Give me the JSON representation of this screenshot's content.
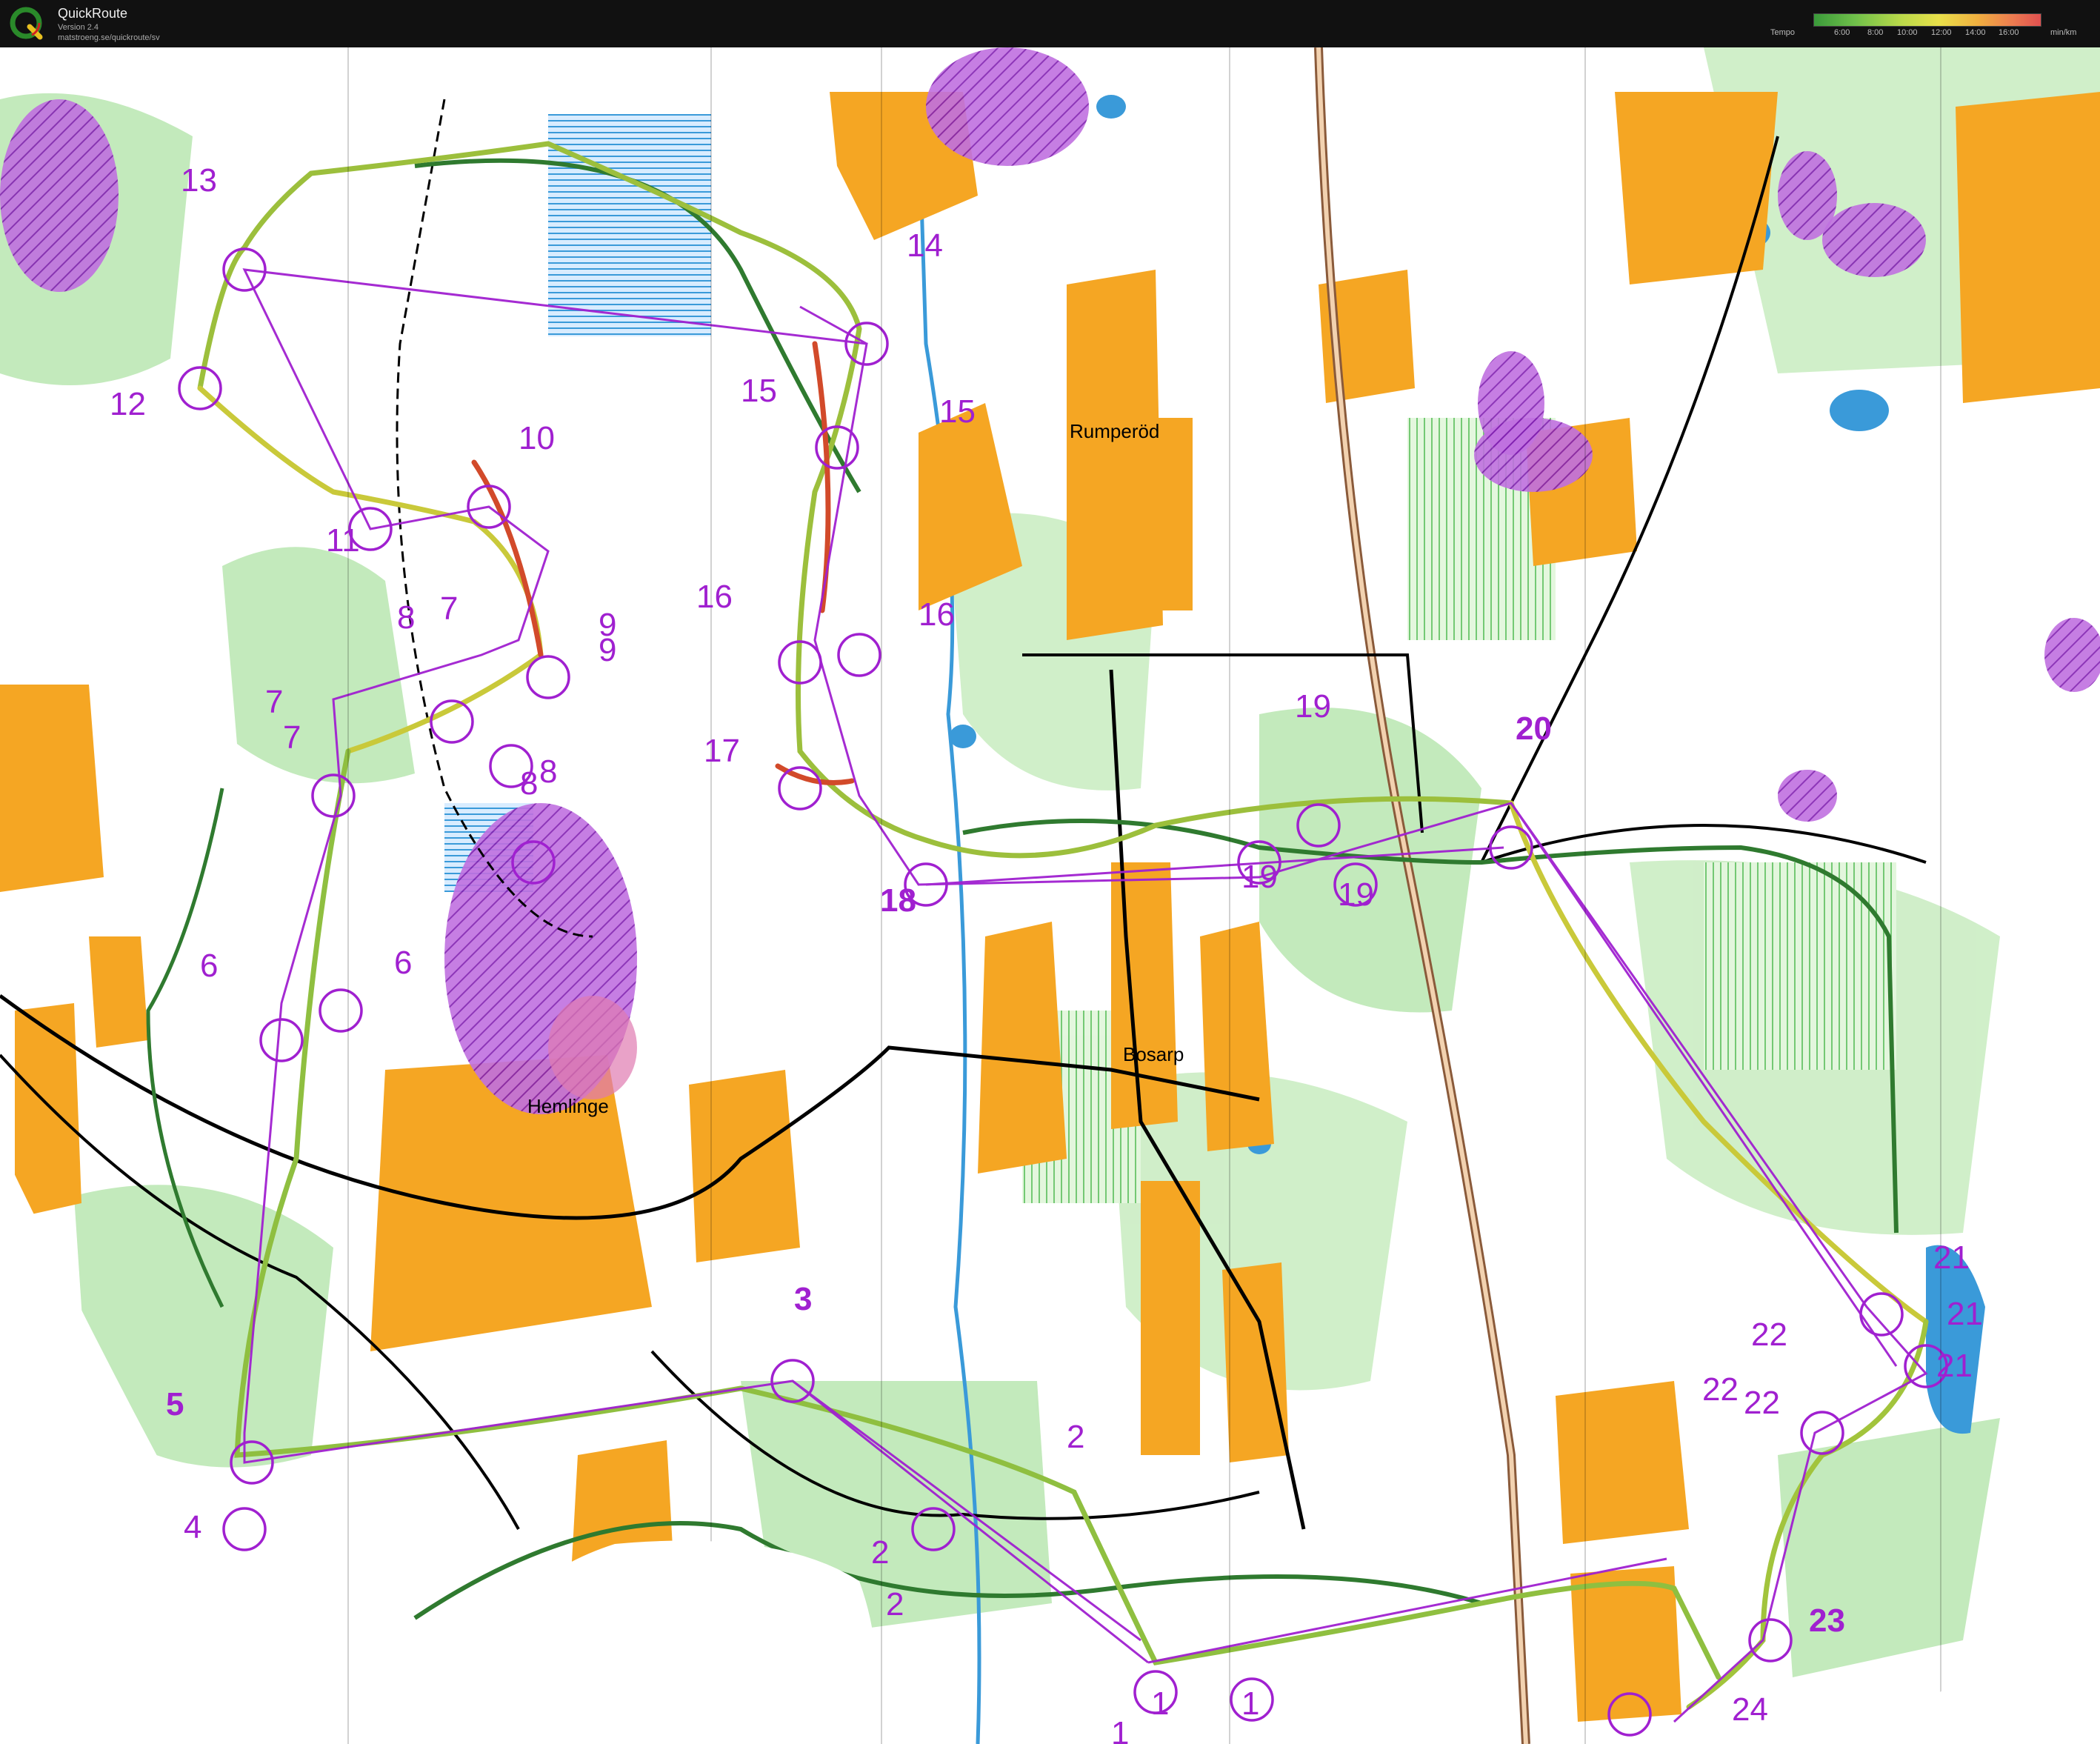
{
  "app": {
    "title": "QuickRoute",
    "version": "Version 2.4",
    "url": "matstroeng.se/quickroute/sv"
  },
  "tempo_legend": {
    "label": "Tempo",
    "ticks": [
      "6:00",
      "8:00",
      "10:00",
      "12:00",
      "14:00",
      "16:00"
    ],
    "unit": "min/km"
  },
  "places": [
    "Rumperöd",
    "Bosarp",
    "Hemlinge"
  ],
  "controls": [
    {
      "text": "13"
    },
    {
      "text": "12"
    },
    {
      "text": "11"
    },
    {
      "text": "10"
    },
    {
      "text": "9"
    },
    {
      "text": "9"
    },
    {
      "text": "8"
    },
    {
      "text": "7"
    },
    {
      "text": "7"
    },
    {
      "text": "7"
    },
    {
      "text": "6"
    },
    {
      "text": "6"
    },
    {
      "text": "5"
    },
    {
      "text": "4"
    },
    {
      "text": "3"
    },
    {
      "text": "2"
    },
    {
      "text": "2"
    },
    {
      "text": "2"
    },
    {
      "text": "1"
    },
    {
      "text": "1"
    },
    {
      "text": "1"
    },
    {
      "text": "14"
    },
    {
      "text": "15"
    },
    {
      "text": "15"
    },
    {
      "text": "16"
    },
    {
      "text": "16"
    },
    {
      "text": "17"
    },
    {
      "text": "18"
    },
    {
      "text": "19"
    },
    {
      "text": "19"
    },
    {
      "text": "19"
    },
    {
      "text": "20"
    },
    {
      "text": "21"
    },
    {
      "text": "21"
    },
    {
      "text": "21"
    },
    {
      "text": "22"
    },
    {
      "text": "22"
    },
    {
      "text": "22"
    },
    {
      "text": "23"
    },
    {
      "text": "24"
    },
    {
      "text": "8"
    },
    {
      "text": "8"
    }
  ],
  "colors": {
    "course": "#a020d0",
    "forest_green": "#8fd68f",
    "open_yellow": "#f5a623",
    "water_blue": "#3a9ad9",
    "forbidden_purple": "#b040d0"
  }
}
